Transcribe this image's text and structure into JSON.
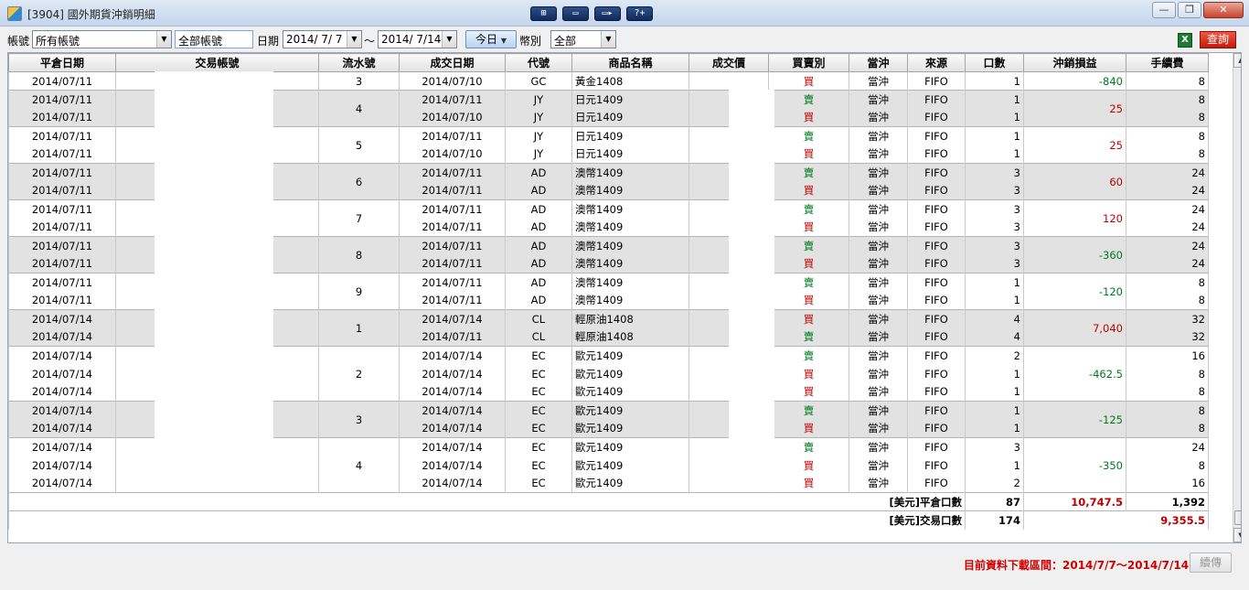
{
  "window": {
    "title": "[3904] 國外期貨沖銷明細",
    "tools": [
      "⊞",
      "▭",
      "▭▸",
      "?+"
    ],
    "minimize": "—",
    "maximize": "❐",
    "close": "✕"
  },
  "toolbar": {
    "account_label": "帳號",
    "account_value": "所有帳號",
    "account_type": "全部帳號",
    "date_label": "日期",
    "date_from": "2014/ 7/ 7",
    "date_sep": "～",
    "date_to": "2014/ 7/14",
    "today_button": "今日",
    "currency_label": "幣別",
    "currency_value": "全部",
    "query_button": "查詢"
  },
  "columns": [
    "平倉日期",
    "交易帳號",
    "流水號",
    "成交日期",
    "代號",
    "商品名稱",
    "成交價",
    "買賣別",
    "當沖",
    "來源",
    "口數",
    "沖銷損益",
    "手續費"
  ],
  "rows": [
    {
      "close_date": "2014/07/11",
      "seq": "3",
      "trade_date": "2014/07/10",
      "code": "GC",
      "product": "黃金1408",
      "side": "買",
      "daytrade": "當沖",
      "source": "FIFO",
      "qty": "1",
      "fee": "8"
    },
    {
      "close_date": "2014/07/11",
      "seq": "4",
      "trade_date": "2014/07/11",
      "code": "JY",
      "product": "日元1409",
      "side": "賣",
      "daytrade": "當沖",
      "source": "FIFO",
      "qty": "1",
      "fee": "8"
    },
    {
      "close_date": "2014/07/11",
      "trade_date": "2014/07/10",
      "code": "JY",
      "product": "日元1409",
      "side": "買",
      "daytrade": "當沖",
      "source": "FIFO",
      "qty": "1",
      "fee": "8"
    },
    {
      "close_date": "2014/07/11",
      "seq": "5",
      "trade_date": "2014/07/11",
      "code": "JY",
      "product": "日元1409",
      "side": "賣",
      "daytrade": "當沖",
      "source": "FIFO",
      "qty": "1",
      "fee": "8"
    },
    {
      "close_date": "2014/07/11",
      "trade_date": "2014/07/10",
      "code": "JY",
      "product": "日元1409",
      "side": "買",
      "daytrade": "當沖",
      "source": "FIFO",
      "qty": "1",
      "fee": "8"
    },
    {
      "close_date": "2014/07/11",
      "seq": "6",
      "trade_date": "2014/07/11",
      "code": "AD",
      "product": "澳幣1409",
      "side": "賣",
      "daytrade": "當沖",
      "source": "FIFO",
      "qty": "3",
      "fee": "24"
    },
    {
      "close_date": "2014/07/11",
      "trade_date": "2014/07/11",
      "code": "AD",
      "product": "澳幣1409",
      "side": "買",
      "daytrade": "當沖",
      "source": "FIFO",
      "qty": "3",
      "fee": "24"
    },
    {
      "close_date": "2014/07/11",
      "seq": "7",
      "trade_date": "2014/07/11",
      "code": "AD",
      "product": "澳幣1409",
      "side": "賣",
      "daytrade": "當沖",
      "source": "FIFO",
      "qty": "3",
      "fee": "24"
    },
    {
      "close_date": "2014/07/11",
      "trade_date": "2014/07/11",
      "code": "AD",
      "product": "澳幣1409",
      "side": "買",
      "daytrade": "當沖",
      "source": "FIFO",
      "qty": "3",
      "fee": "24"
    },
    {
      "close_date": "2014/07/11",
      "seq": "8",
      "trade_date": "2014/07/11",
      "code": "AD",
      "product": "澳幣1409",
      "side": "賣",
      "daytrade": "當沖",
      "source": "FIFO",
      "qty": "3",
      "fee": "24"
    },
    {
      "close_date": "2014/07/11",
      "trade_date": "2014/07/11",
      "code": "AD",
      "product": "澳幣1409",
      "side": "買",
      "daytrade": "當沖",
      "source": "FIFO",
      "qty": "3",
      "fee": "24"
    },
    {
      "close_date": "2014/07/11",
      "seq": "9",
      "trade_date": "2014/07/11",
      "code": "AD",
      "product": "澳幣1409",
      "side": "賣",
      "daytrade": "當沖",
      "source": "FIFO",
      "qty": "1",
      "fee": "8"
    },
    {
      "close_date": "2014/07/11",
      "trade_date": "2014/07/11",
      "code": "AD",
      "product": "澳幣1409",
      "side": "買",
      "daytrade": "當沖",
      "source": "FIFO",
      "qty": "1",
      "fee": "8"
    },
    {
      "close_date": "2014/07/14",
      "seq": "1",
      "trade_date": "2014/07/14",
      "code": "CL",
      "product": "輕原油1408",
      "side": "買",
      "daytrade": "當沖",
      "source": "FIFO",
      "qty": "4",
      "fee": "32"
    },
    {
      "close_date": "2014/07/14",
      "trade_date": "2014/07/11",
      "code": "CL",
      "product": "輕原油1408",
      "side": "賣",
      "daytrade": "當沖",
      "source": "FIFO",
      "qty": "4",
      "fee": "32"
    },
    {
      "close_date": "2014/07/14",
      "seq": "2",
      "trade_date": "2014/07/14",
      "code": "EC",
      "product": "歐元1409",
      "side": "賣",
      "daytrade": "當沖",
      "source": "FIFO",
      "qty": "2",
      "fee": "16"
    },
    {
      "close_date": "2014/07/14",
      "trade_date": "2014/07/14",
      "code": "EC",
      "product": "歐元1409",
      "side": "買",
      "daytrade": "當沖",
      "source": "FIFO",
      "qty": "1",
      "fee": "8"
    },
    {
      "close_date": "2014/07/14",
      "trade_date": "2014/07/14",
      "code": "EC",
      "product": "歐元1409",
      "side": "買",
      "daytrade": "當沖",
      "source": "FIFO",
      "qty": "1",
      "fee": "8"
    },
    {
      "close_date": "2014/07/14",
      "seq": "3",
      "trade_date": "2014/07/14",
      "code": "EC",
      "product": "歐元1409",
      "side": "賣",
      "daytrade": "當沖",
      "source": "FIFO",
      "qty": "1",
      "fee": "8"
    },
    {
      "close_date": "2014/07/14",
      "trade_date": "2014/07/14",
      "code": "EC",
      "product": "歐元1409",
      "side": "買",
      "daytrade": "當沖",
      "source": "FIFO",
      "qty": "1",
      "fee": "8"
    },
    {
      "close_date": "2014/07/14",
      "seq": "4",
      "trade_date": "2014/07/14",
      "code": "EC",
      "product": "歐元1409",
      "side": "賣",
      "daytrade": "當沖",
      "source": "FIFO",
      "qty": "3",
      "fee": "24"
    },
    {
      "close_date": "2014/07/14",
      "trade_date": "2014/07/14",
      "code": "EC",
      "product": "歐元1409",
      "side": "買",
      "daytrade": "當沖",
      "source": "FIFO",
      "qty": "1",
      "fee": "8"
    },
    {
      "close_date": "2014/07/14",
      "trade_date": "2014/07/14",
      "code": "EC",
      "product": "歐元1409",
      "side": "買",
      "daytrade": "當沖",
      "source": "FIFO",
      "qty": "2",
      "fee": "16"
    }
  ],
  "groups": [
    {
      "seq": "3",
      "start": 0,
      "span": 1,
      "pl": "-840",
      "shade": false
    },
    {
      "seq": "4",
      "start": 1,
      "span": 2,
      "pl": "25",
      "shade": true
    },
    {
      "seq": "5",
      "start": 3,
      "span": 2,
      "pl": "25",
      "shade": false
    },
    {
      "seq": "6",
      "start": 5,
      "span": 2,
      "pl": "60",
      "shade": true
    },
    {
      "seq": "7",
      "start": 7,
      "span": 2,
      "pl": "120",
      "shade": false
    },
    {
      "seq": "8",
      "start": 9,
      "span": 2,
      "pl": "-360",
      "shade": true
    },
    {
      "seq": "9",
      "start": 11,
      "span": 2,
      "pl": "-120",
      "shade": false
    },
    {
      "seq": "1",
      "start": 13,
      "span": 2,
      "pl": "7,040",
      "shade": true
    },
    {
      "seq": "2",
      "start": 15,
      "span": 3,
      "pl": "-462.5",
      "shade": false
    },
    {
      "seq": "3",
      "start": 18,
      "span": 2,
      "pl": "-125",
      "shade": true
    },
    {
      "seq": "4",
      "start": 20,
      "span": 3,
      "pl": "-350",
      "shade": false
    }
  ],
  "summary": {
    "close_label": "[美元]平倉口數",
    "close_qty": "87",
    "close_pl": "10,747.5",
    "close_fee": "1,392",
    "trade_label": "[美元]交易口數",
    "trade_qty": "174",
    "trade_net": "9,355.5"
  },
  "footer": {
    "info": "目前資料下載區間：2014/7/7～2014/7/14",
    "resume_button": "續傳"
  },
  "colors": {
    "buy": "#c00000",
    "sell": "#007a1f",
    "query_bg": "#d8220e",
    "info": "#d00000"
  }
}
